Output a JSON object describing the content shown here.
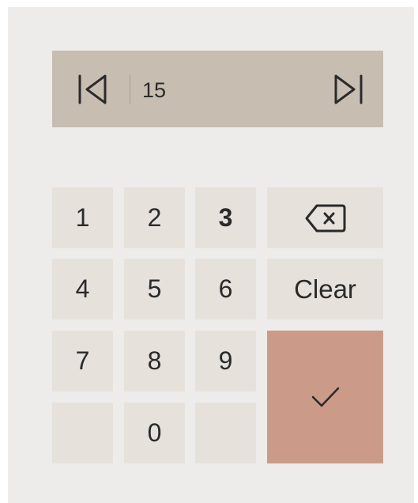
{
  "header": {
    "value": "15",
    "first_icon": "skip-to-first-icon",
    "last_icon": "skip-to-last-icon"
  },
  "keypad": {
    "digits": [
      "1",
      "2",
      "3",
      "4",
      "5",
      "6",
      "7",
      "8",
      "9",
      "0"
    ],
    "highlighted_digit": "3",
    "backspace_icon": "backspace-icon",
    "clear_label": "Clear",
    "confirm_icon": "checkmark-icon"
  },
  "colors": {
    "panel": "#eeecea",
    "header": "#c8bdb1",
    "key": "#e6e1db",
    "confirm": "#cc9a89"
  }
}
